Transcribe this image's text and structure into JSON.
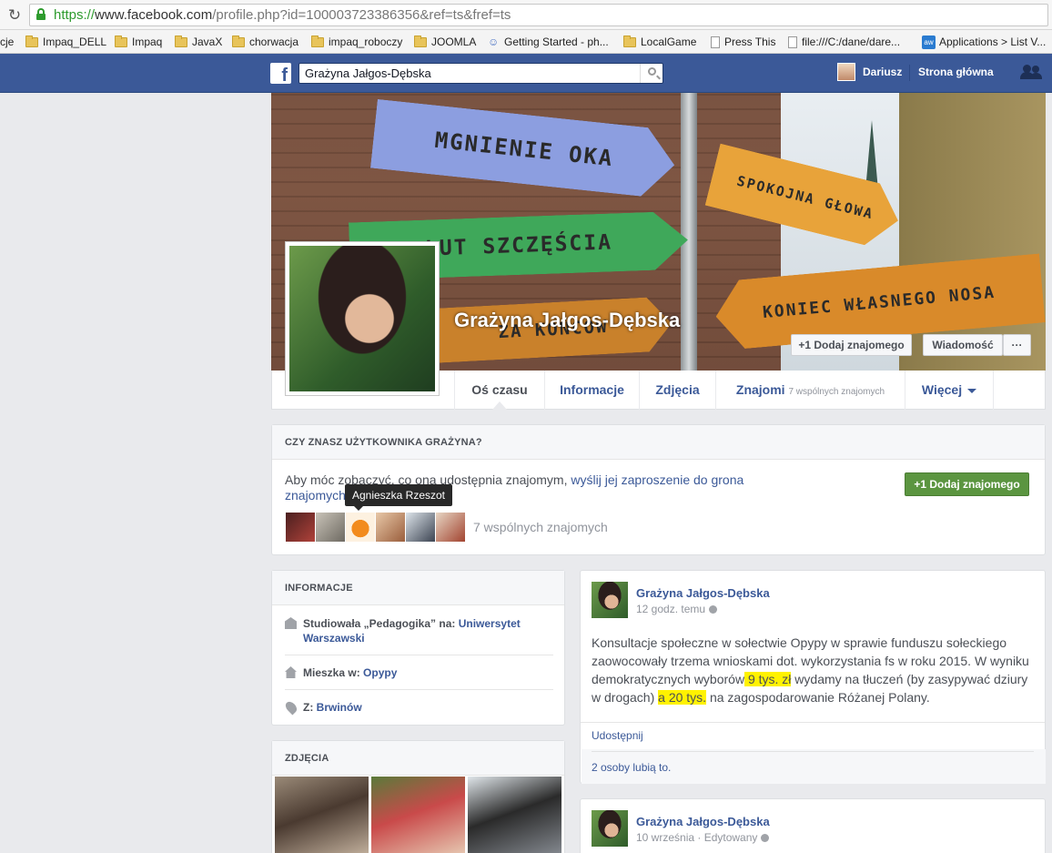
{
  "browser": {
    "url_secure": "https://",
    "url_host": "www.facebook.com",
    "url_path": "/profile.php?id=100003723386356&ref=ts&fref=ts",
    "bookmarks": [
      {
        "label": "cje",
        "icon": "none"
      },
      {
        "label": "Impaq_DELL",
        "icon": "folder-icon"
      },
      {
        "label": "Impaq",
        "icon": "folder-icon"
      },
      {
        "label": "JavaX",
        "icon": "folder-icon"
      },
      {
        "label": "chorwacja",
        "icon": "folder-icon"
      },
      {
        "label": "impaq_roboczy",
        "icon": "folder-icon"
      },
      {
        "label": "JOOMLA",
        "icon": "folder-icon"
      },
      {
        "label": "Getting Started - ph...",
        "icon": "people-icon"
      },
      {
        "label": "LocalGame",
        "icon": "folder-icon"
      },
      {
        "label": "Press This",
        "icon": "page-icon"
      },
      {
        "label": "file:///C:/dane/dare...",
        "icon": "page-icon"
      },
      {
        "label": "Applications > List V...",
        "icon": "aw-icon"
      }
    ]
  },
  "topbar": {
    "logo": "f",
    "search_value": "Grażyna Jałgos-Dębska",
    "user_name": "Dariusz",
    "home_label": "Strona główna",
    "brand_color": "#3b5998"
  },
  "cover": {
    "signs": [
      "MGNIENIE OKA",
      "LUT SZCZĘŚCIA",
      "SPOKOJNA GŁOWA",
      "KONIEC WŁASNEGO NOSA",
      "ZA KOŃCÓW"
    ]
  },
  "profile": {
    "name": "Grażyna Jałgos-Dębska",
    "add_friend": "Dodaj znajomego",
    "message": "Wiadomość",
    "more": "···"
  },
  "tabs": {
    "timeline": "Oś czasu",
    "about": "Informacje",
    "photos": "Zdjęcia",
    "friends": "Znajomi",
    "friends_sub": "7 wspólnych znajomych",
    "more": "Więcej"
  },
  "know": {
    "header": "CZY ZNASZ UŻYTKOWNIKA GRAŻYNA?",
    "text_prefix": "Aby móc zobaczyć, co ona udostępnia znajomym,",
    "text_link": "wyślij jej zaproszenie do grona znajomych.",
    "add_button": "Dodaj znajomego",
    "tooltip": "Agnieszka Rzeszot",
    "mutual": "7 wspólnych znajomych"
  },
  "info": {
    "header": "INFORMACJE",
    "studied_prefix": "Studiowała „Pedagogika” na:",
    "studied_link": "Uniwersytet Warszawski",
    "lives_prefix": "Mieszka w:",
    "lives_link": "Opypy",
    "from_prefix": "Z:",
    "from_link": "Brwinów"
  },
  "photos": {
    "header": "ZDJĘCIA"
  },
  "post1": {
    "author": "Grażyna Jałgos-Dębska",
    "time": "12 godz. temu",
    "text_a": "Konsultacje społeczne w sołectwie Opypy w sprawie funduszu sołeckiego zaowocowały trzema wnioskami dot. wykorzystania fs w roku 2015. W wyniku demokratycznych wyborów",
    "hl1": " 9 tys. zł",
    "text_b": " wydamy na tłuczeń (by zasypywać dziury w drogach) ",
    "hl2": "a 20 tys.",
    "text_c": " na zagospodarowanie Różanej Polany.",
    "share": "Udostępnij",
    "likes": "2 osoby lubią to."
  },
  "post2": {
    "author": "Grażyna Jałgos-Dębska",
    "time": "10 września · Edytowany"
  }
}
